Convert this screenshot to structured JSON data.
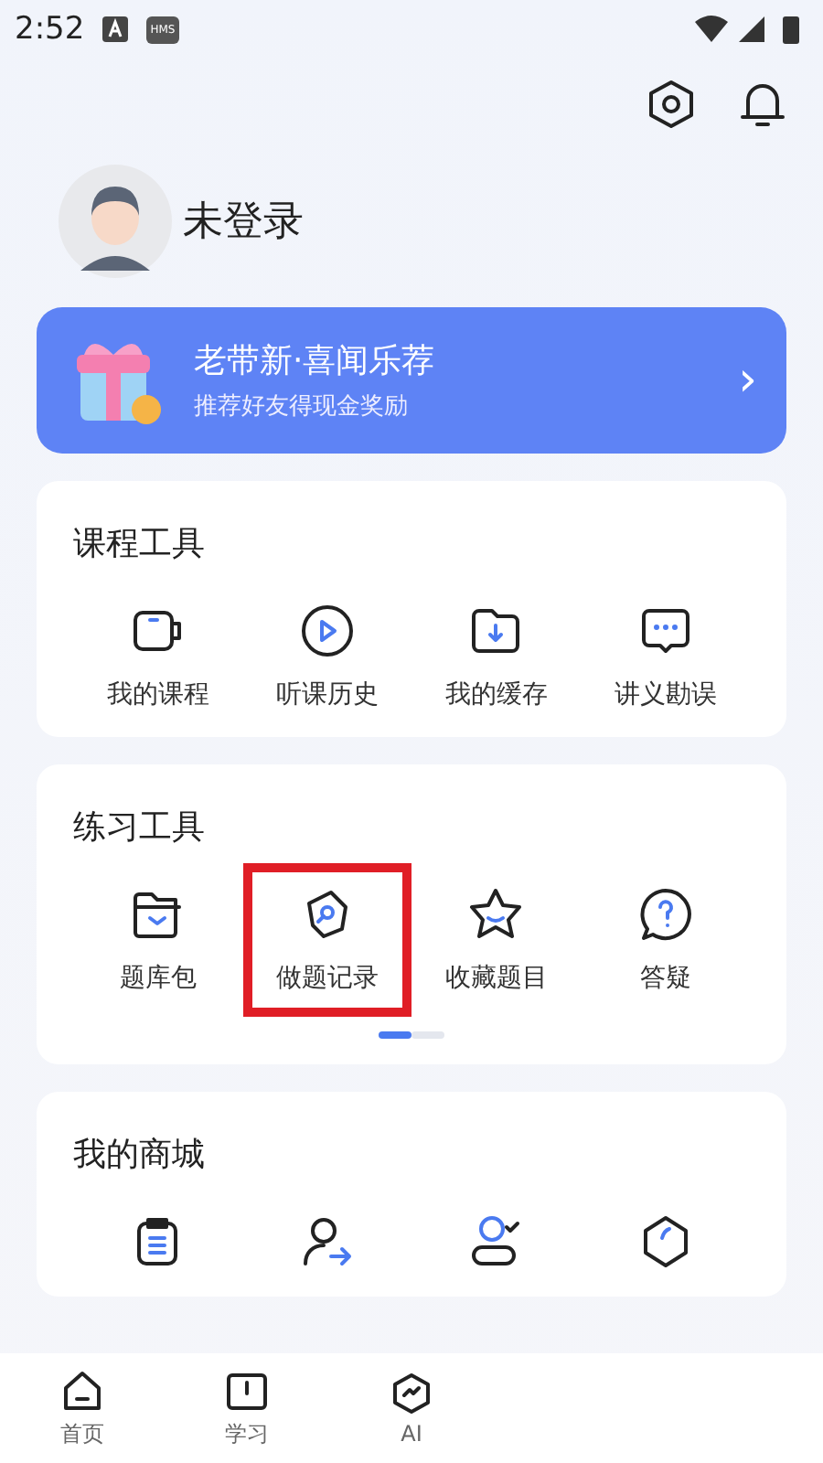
{
  "status_bar": {
    "time": "2:52",
    "badge": "HMS"
  },
  "profile": {
    "name": "未登录"
  },
  "banner": {
    "title": "老带新·喜闻乐荐",
    "subtitle": "推荐好友得现金奖励",
    "arrow": "›"
  },
  "sections": [
    {
      "title": "课程工具",
      "tools": [
        {
          "kind": "camera",
          "label": "我的课程",
          "highlighted": false
        },
        {
          "kind": "play",
          "label": "听课历史",
          "highlighted": false
        },
        {
          "kind": "download",
          "label": "我的缓存",
          "highlighted": false
        },
        {
          "kind": "chat",
          "label": "讲义勘误",
          "highlighted": false
        }
      ]
    },
    {
      "title": "练习工具",
      "tools": [
        {
          "kind": "folder",
          "label": "题库包",
          "highlighted": false
        },
        {
          "kind": "record",
          "label": "做题记录",
          "highlighted": true
        },
        {
          "kind": "star",
          "label": "收藏题目",
          "highlighted": false
        },
        {
          "kind": "question",
          "label": "答疑",
          "highlighted": false
        }
      ],
      "pager": [
        {
          "selected": true
        },
        {
          "selected": false
        }
      ]
    },
    {
      "title": "我的商城",
      "tools": [
        {
          "kind": "clipboard"
        },
        {
          "kind": "user-arrow"
        },
        {
          "kind": "user-check"
        },
        {
          "kind": "hexagon"
        }
      ]
    }
  ],
  "nav": [
    {
      "kind": "home",
      "label": "首页"
    },
    {
      "kind": "book",
      "label": "学习"
    },
    {
      "kind": "ai",
      "label": "AI"
    }
  ]
}
